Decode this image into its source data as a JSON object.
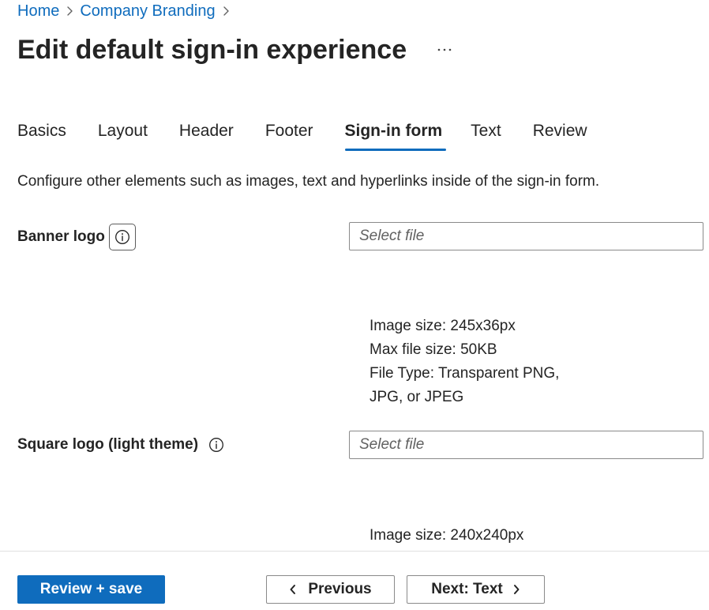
{
  "breadcrumb": {
    "items": [
      {
        "label": "Home"
      },
      {
        "label": "Company Branding"
      }
    ]
  },
  "header": {
    "title": "Edit default sign-in experience",
    "more_icon": "ellipsis-icon"
  },
  "tabs": [
    {
      "label": "Basics",
      "active": false
    },
    {
      "label": "Layout",
      "active": false
    },
    {
      "label": "Header",
      "active": false
    },
    {
      "label": "Footer",
      "active": false
    },
    {
      "label": "Sign-in form",
      "active": true
    },
    {
      "label": "Text",
      "active": false
    },
    {
      "label": "Review",
      "active": false
    }
  ],
  "description": "Configure other elements such as images, text and hyperlinks inside of the sign-in form.",
  "fields": {
    "banner_logo": {
      "label": "Banner logo",
      "placeholder": "Select file",
      "value": "",
      "hints": [
        "Image size: 245x36px",
        "Max file size: 50KB",
        "File Type: Transparent PNG,",
        "JPG, or JPEG"
      ]
    },
    "square_logo_light": {
      "label": "Square logo (light theme)",
      "placeholder": "Select file",
      "value": "",
      "hints": [
        "Image size: 240x240px"
      ]
    }
  },
  "footer": {
    "review_save_label": "Review + save",
    "previous_label": "Previous",
    "next_label": "Next: Text"
  },
  "colors": {
    "accent": "#0f6cbd",
    "text": "#242424",
    "border": "#8a8a8a"
  }
}
